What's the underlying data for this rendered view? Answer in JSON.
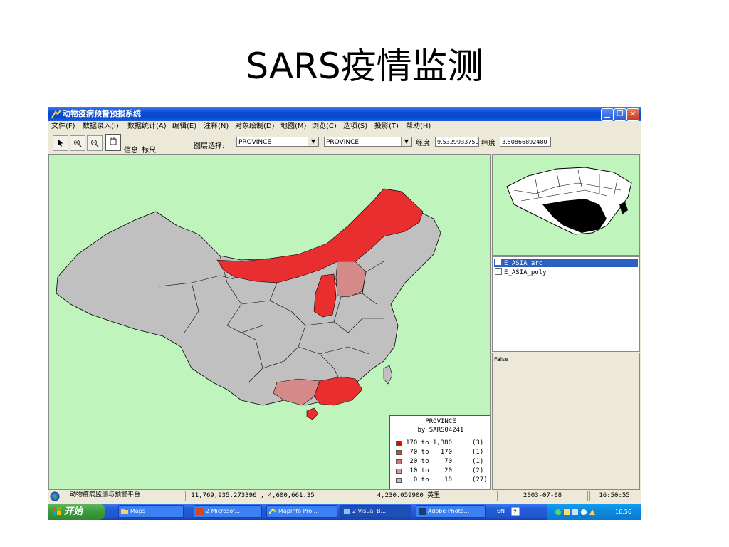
{
  "slide": {
    "title": "SARS疫情监测"
  },
  "window": {
    "title": "动物疫病预警预报系统"
  },
  "menu": [
    "文件(F)",
    "数据录入(I)",
    "数据统计(A)",
    "编辑(E)",
    "注释(N)",
    "对象绘制(D)",
    "地图(M)",
    "浏览(C)",
    "选项(S)",
    "投影(T)",
    "帮助(H)"
  ],
  "toolbar": {
    "info_label": "信息",
    "ruler_label": "标尺",
    "layer_select_label": "图层选择:",
    "layer_combo1": "PROVINCE",
    "layer_combo2": "PROVINCE",
    "longitude_label": "经度",
    "longitude_value": "9.5329933759",
    "latitude_label": "纬度",
    "latitude_value": "3.50866892480"
  },
  "legend": {
    "title": "PROVINCE",
    "subtitle": "by SARS0424I",
    "rows": [
      {
        "range": "170 to 1,380",
        "count": "(3)",
        "color": "#e00000"
      },
      {
        "range": " 70 to   170",
        "count": "(1)",
        "color": "#e24040"
      },
      {
        "range": " 20 to    70",
        "count": "(1)",
        "color": "#de7070"
      },
      {
        "range": " 10 to    20",
        "count": "(2)",
        "color": "#d29a9a"
      },
      {
        "range": "  0 to    10",
        "count": "(27)",
        "color": "#c0c0c0"
      }
    ]
  },
  "map_colors": {
    "background": "#bff5bc",
    "province": "#c0c0c0",
    "high": "#e82e2e",
    "mid": "#d58a8a"
  },
  "layers": [
    "E_ASIA_arc",
    "E_ASIA_poly"
  ],
  "info_panel": {
    "value": "False"
  },
  "status": {
    "app_name": "动物疫病监测与预警平台",
    "coords": "11,769,935.273396 , 4,600,661.35",
    "distance": "4,230.059900 英里",
    "date": "2003-07-08",
    "time": "16:50:55"
  },
  "taskbar": {
    "start": "开始",
    "tasks": [
      "Maps",
      "2 Microsof...",
      "MapInfo Pro...",
      "2 Visual B...",
      "Adobe Photo..."
    ],
    "lang": "EN",
    "clock": "16:56"
  }
}
